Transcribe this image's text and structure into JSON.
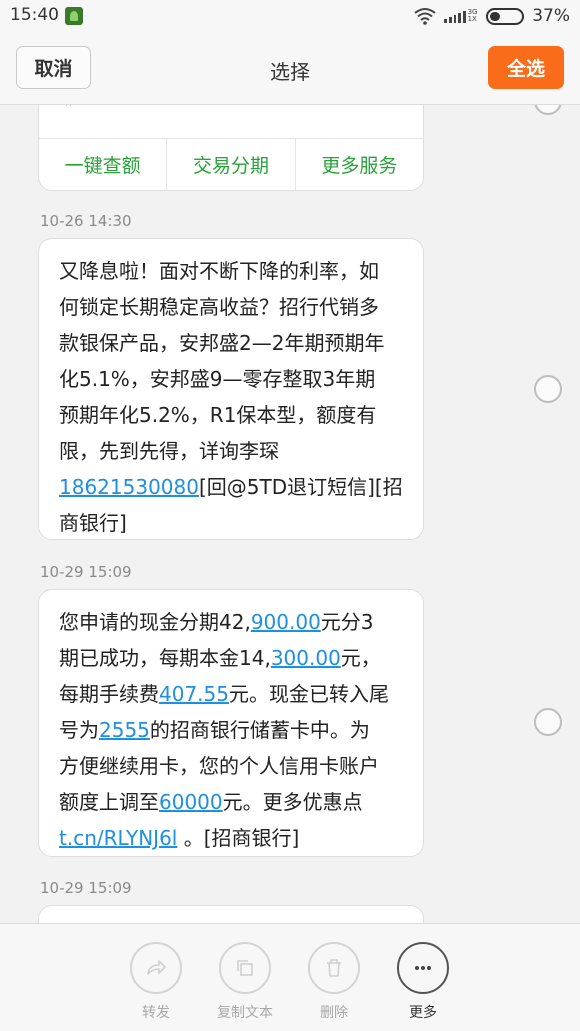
{
  "status_bar": {
    "time": "15:40",
    "network": "3G\n1X",
    "battery": "37%"
  },
  "header": {
    "cancel_label": "取消",
    "title": "选择",
    "select_all_label": "全选"
  },
  "card": {
    "partial_text": "« ·······  ·········",
    "actions": [
      "一键查额",
      "交易分期",
      "更多服务"
    ]
  },
  "messages": [
    {
      "timestamp": "10-26 14:30",
      "lines": [
        "又降息啦！面对不断下降的利率，如",
        "何锁定长期稳定高收益？招行代销多",
        "款银保产品，安邦盛2—2年期预期年",
        "化5.1%，安邦盛9—零存整取3年期",
        "预期年化5.2%，R1保本型，额度有",
        "限，先到先得，详询李琛"
      ],
      "link_phone": "18621530080",
      "tail_1": "[回@5TD退订短信][招",
      "tail_2": "商银行]"
    },
    {
      "timestamp": "10-29 15:09",
      "p1": "您申请的现金分期42,",
      "l1": "900.00",
      "p2": "元分3",
      "p3": "期已成功，每期本金14,",
      "l2": "300.00",
      "p4": "元，",
      "p5": "每期手续费",
      "l3": "407.55",
      "p6": "元。现金已转入尾",
      "p7": "号为",
      "l4": "2555",
      "p8": "的招商银行储蓄卡中。为",
      "p9": "方便继续用卡，您的个人信用卡账户",
      "p10": "额度上调至",
      "l5": "60000",
      "p11": "元。更多优惠点",
      "l6": "t.cn/RLYNJ6l",
      "p12": " 。[招商银行]"
    },
    {
      "timestamp": "10-29 15:09"
    }
  ],
  "bottom_actions": [
    {
      "label": "转发",
      "icon": "forward-icon"
    },
    {
      "label": "复制文本",
      "icon": "copy-icon"
    },
    {
      "label": "删除",
      "icon": "trash-icon"
    },
    {
      "label": "更多",
      "icon": "more-icon"
    }
  ],
  "colors": {
    "accent": "#f86c1a",
    "link": "#1f8fe0",
    "card_action": "#28a33a"
  }
}
